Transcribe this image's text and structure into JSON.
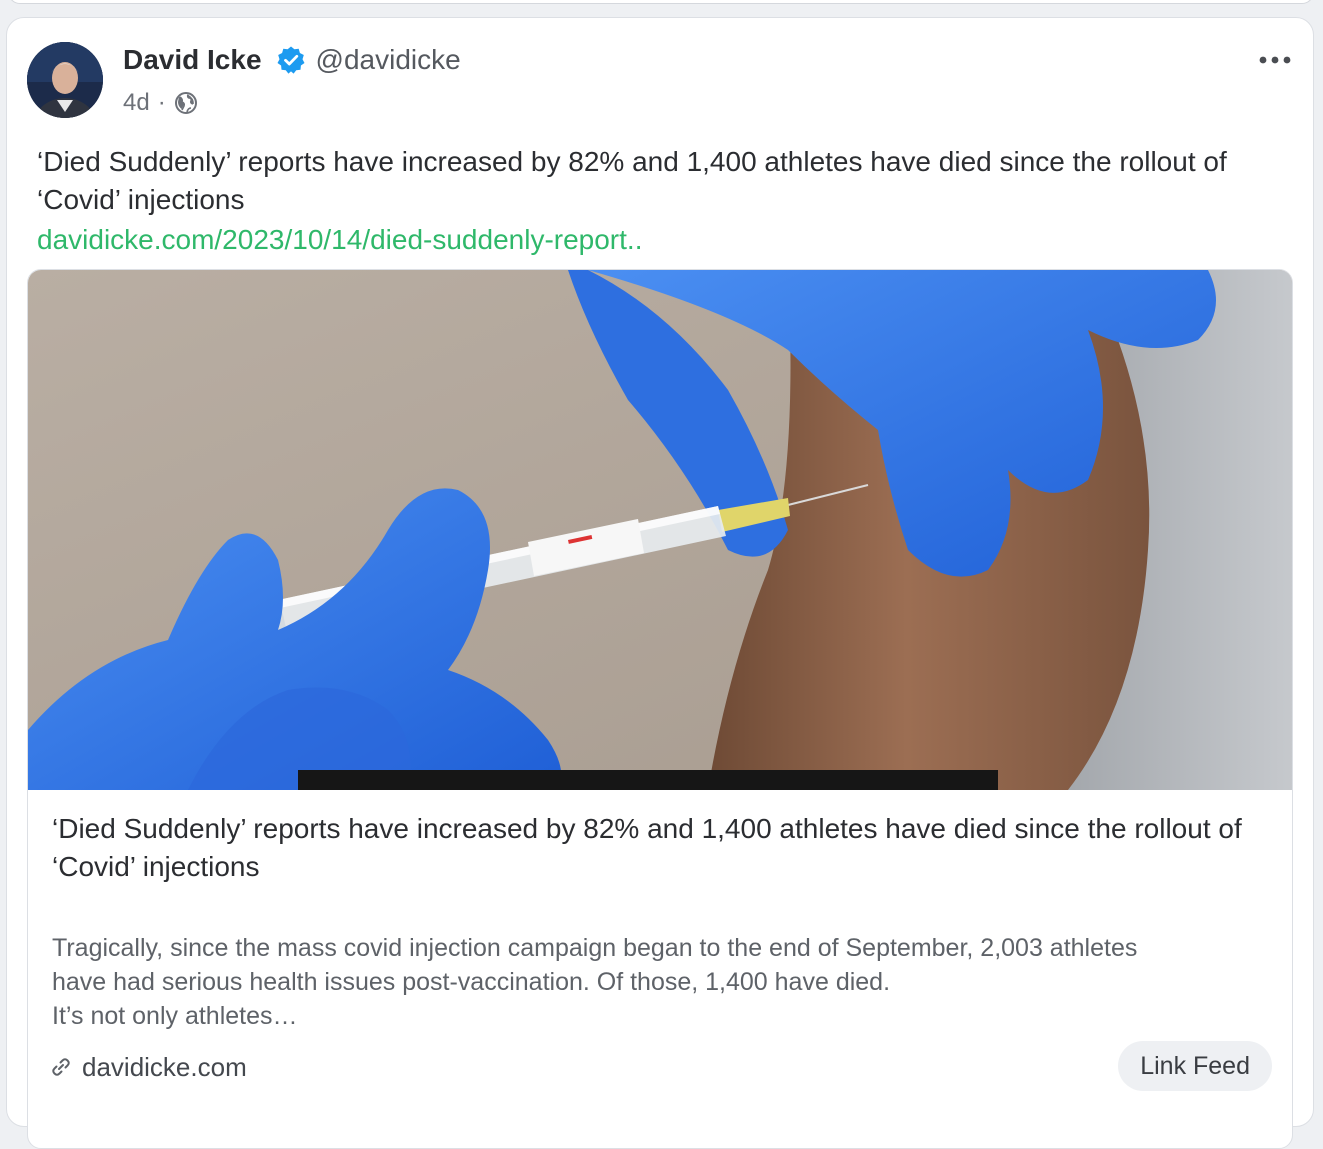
{
  "post": {
    "author_name": "David Icke",
    "handle": "@davidicke",
    "time_ago": "4d",
    "separator": "·",
    "text": "‘Died Suddenly’ reports have increased by 82% and 1,400 athletes have died since the rollout of ‘Covid’ injections",
    "link_text": "davidicke.com/2023/10/14/died-suddenly-report..",
    "icons": {
      "verified": "verified-badge-icon",
      "visibility": "globe-icon",
      "menu": "more-horizontal-icon",
      "link": "link-icon"
    },
    "colors": {
      "link": "#2fb86a",
      "verified": "#1d9bf0"
    }
  },
  "link_card": {
    "title": "‘Died Suddenly’ reports have increased by 82% and 1,400 athletes have died since the rollout of ‘Covid’ injections",
    "description_lines": [
      "Tragically, since the mass covid injection campaign began to the end of September, 2,003 athletes",
      "have had serious health issues post-vaccination.  Of those, 1,400 have died.",
      "It’s not only athletes…"
    ],
    "domain": "davidicke.com",
    "feed_button_label": "Link Feed"
  }
}
